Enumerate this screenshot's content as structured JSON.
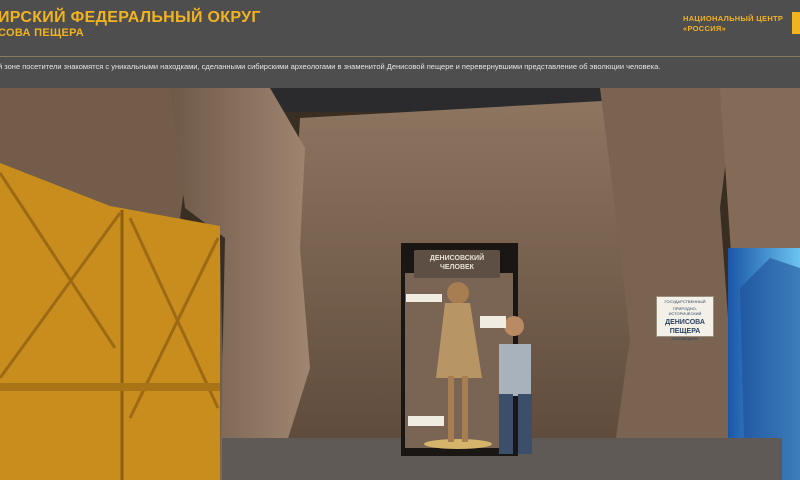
{
  "header": {
    "title": "ИРСКИЙ ФЕДЕРАЛЬНЫЙ ОКРУГ",
    "subtitle": "СОВА ПЕЩЕРА",
    "national_center_line1": "НАЦИОНАЛЬНЫЙ ЦЕНТР",
    "national_center_line2": "«РОССИЯ»",
    "description": "й зоне посетители знакомятся с уникальными находками, сделанными сибирскими археологами в знаменитой Денисовой пещере и перевернувшими представление об эволюции человека."
  },
  "scene": {
    "panel_title_line1": "ДЕНИСОВСКИЙ",
    "panel_title_line2": "ЧЕЛОВЕК",
    "sign_line1": "ГОСУДАРСТВЕННЫЙ",
    "sign_line2": "ПРИРОДНО-ИСТОРИЧЕСКИЙ",
    "sign_line3": "ДЕНИСОВА ПЕЩЕРА",
    "sign_line4": "ЗАПОВЕДНИК"
  },
  "colors": {
    "accent": "#f2b321",
    "header_bg": "#4e4e4e",
    "door": "#c88d1d"
  }
}
